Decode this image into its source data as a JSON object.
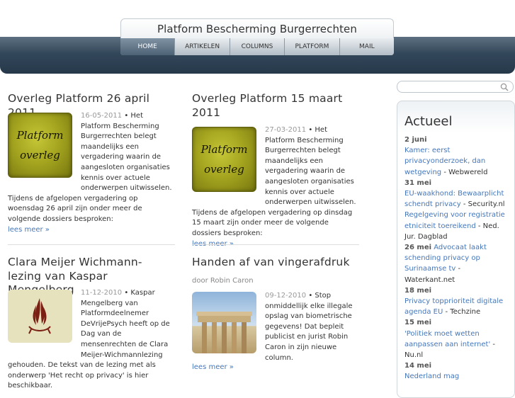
{
  "site": {
    "title": "Platform Bescherming Burgerrechten"
  },
  "nav": [
    {
      "label": "HOME"
    },
    {
      "label": "ARTIKELEN"
    },
    {
      "label": "COLUMNS"
    },
    {
      "label": "PLATFORM"
    },
    {
      "label": "MAIL"
    }
  ],
  "thumb_text": {
    "line1": "Platform",
    "line2": "overleg"
  },
  "articles": [
    {
      "title": "Overleg Platform 26 april 2011",
      "date": "16-05-2011",
      "intro": "Het Platform Bescherming Burgerrechten belegt maandelijks een vergadering waarin de aangesloten organisaties kennis over actuele onderwerpen uitwisselen. Tijdens de afgelopen vergadering op woensdag 26 april zijn onder meer de volgende dossiers besproken:",
      "read_more": "lees meer »"
    },
    {
      "title": "Overleg Platform 15 maart 2011",
      "date": "27-03-2011",
      "intro": "Het Platform Bescherming Burgerrechten belegt maandelijks een vergadering waarin de aangesloten organisaties kennis over actuele onderwerpen uitwisselen. Tijdens de afgelopen vergadering op dinsdag 15 maart zijn onder meer de volgende dossiers besproken:",
      "read_more": "lees meer »"
    },
    {
      "title": "Clara Meijer Wichmann-lezing van Kaspar Mengelberg",
      "date": "11-12-2010",
      "intro": "Kaspar Mengelberg van Platformdeelnemer DeVrijePsych heeft op de Dag van de mensenrechten de Clara Meijer-Wichmannlezing gehouden. De tekst van de lezing met als onderwerp 'Het recht op privacy' is hier beschikbaar."
    },
    {
      "title": "Handen af van vingerafdruk",
      "byline": "door Robin Caron",
      "date": "09-12-2010",
      "intro": "Stop onmiddellijk elke illegale opslag van biometrische gegevens! Dat bepleit publicist en jurist Robin Caron in zijn nieuwe column.",
      "read_more": "lees meer »"
    }
  ],
  "sidebar": {
    "heading": "Actueel",
    "news": [
      {
        "date": "2 juni",
        "link": "Kamer: eerst privacyonderzoek, dan wetgeving",
        "source": "Webwereld"
      },
      {
        "date": "31 mei",
        "link": "EU-waakhond: Bewaarplicht schendt privacy",
        "source": "Security.nl"
      },
      {
        "date": "",
        "link": "Regelgeving voor registratie etniciteit toereikend",
        "source": "Ned. Jur. Dagblad"
      },
      {
        "date": "26 mei",
        "link": "Advocaat laakt schending privacy op Surinaamse tv",
        "source": "Waterkant.net"
      },
      {
        "date": "18 mei",
        "link": "Privacy topprioriteit digitale agenda EU",
        "source": "Techzine"
      },
      {
        "date": "15 mei",
        "link": "'Politiek moet wetten aanpassen aan internet'",
        "source": "Nu.nl"
      },
      {
        "date": "14 mei",
        "link": "Nederland mag",
        "source": ""
      }
    ]
  },
  "colors": {
    "accent": "#4477bb",
    "header": "#33475a",
    "thumb": "#a5a520"
  }
}
